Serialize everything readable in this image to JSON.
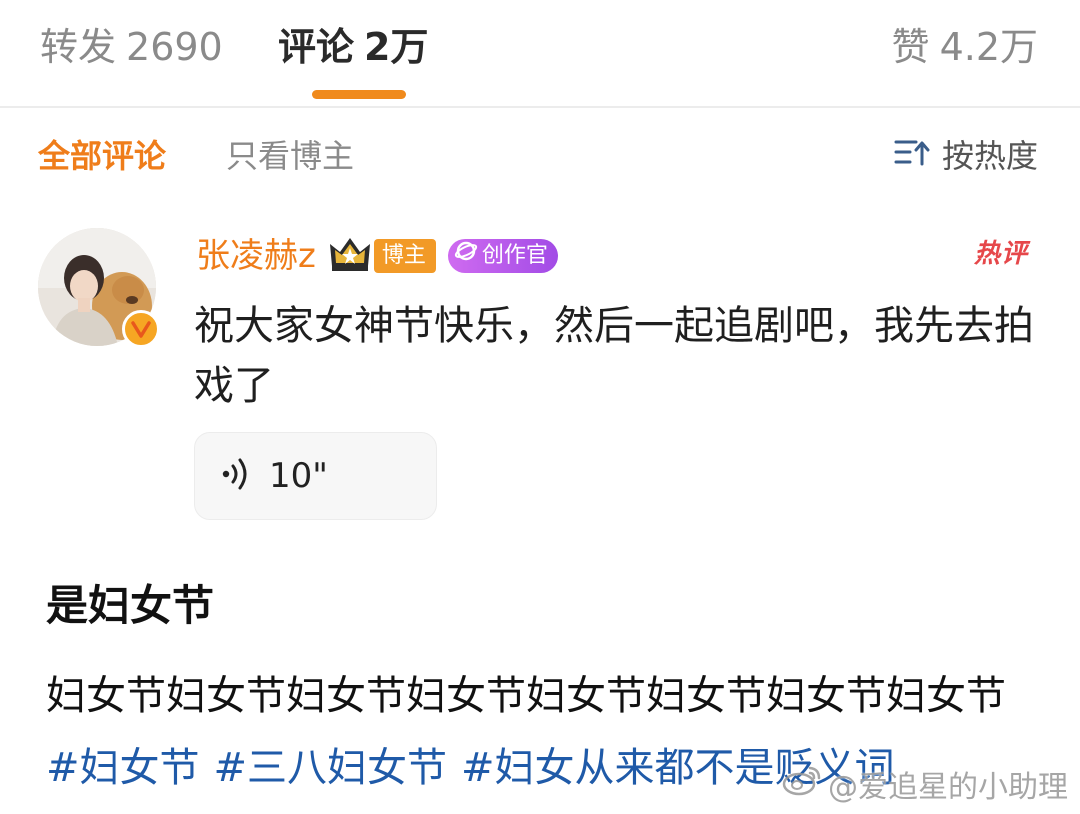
{
  "tabs": {
    "repost": {
      "label": "转发",
      "count": "2690"
    },
    "comments": {
      "label": "评论",
      "count": "2万"
    },
    "likes": {
      "label": "赞",
      "count": "4.2万"
    }
  },
  "filters": {
    "all": "全部评论",
    "blogger_only": "只看博主",
    "sort": "按热度"
  },
  "comment": {
    "username": "张凌赫z",
    "badge_blogger": "博主",
    "badge_creator": "创作官",
    "hot_tag": "热评",
    "text": "祝大家女神节快乐，然后一起追剧吧，我先去拍戏了",
    "voice_duration": "10\""
  },
  "article": {
    "title": "是妇女节",
    "body": "妇女节妇女节妇女节妇女节妇女节妇女节妇女节妇女节",
    "hashtags": [
      "#妇女节",
      "#三八妇女节",
      "#妇女从来都不是贬义词"
    ]
  },
  "watermark": "@爱追星的小助理",
  "colors": {
    "accent_orange": "#ef7d1a",
    "hashtag_blue": "#1f5aa8",
    "hot_red": "#e6474a",
    "creator_purple": "#a24be6"
  },
  "icons": {
    "sort": "sort-icon",
    "verified": "verified-v-icon",
    "crown": "crown-icon",
    "voice": "voice-wave-icon",
    "weibo": "weibo-logo-icon"
  }
}
